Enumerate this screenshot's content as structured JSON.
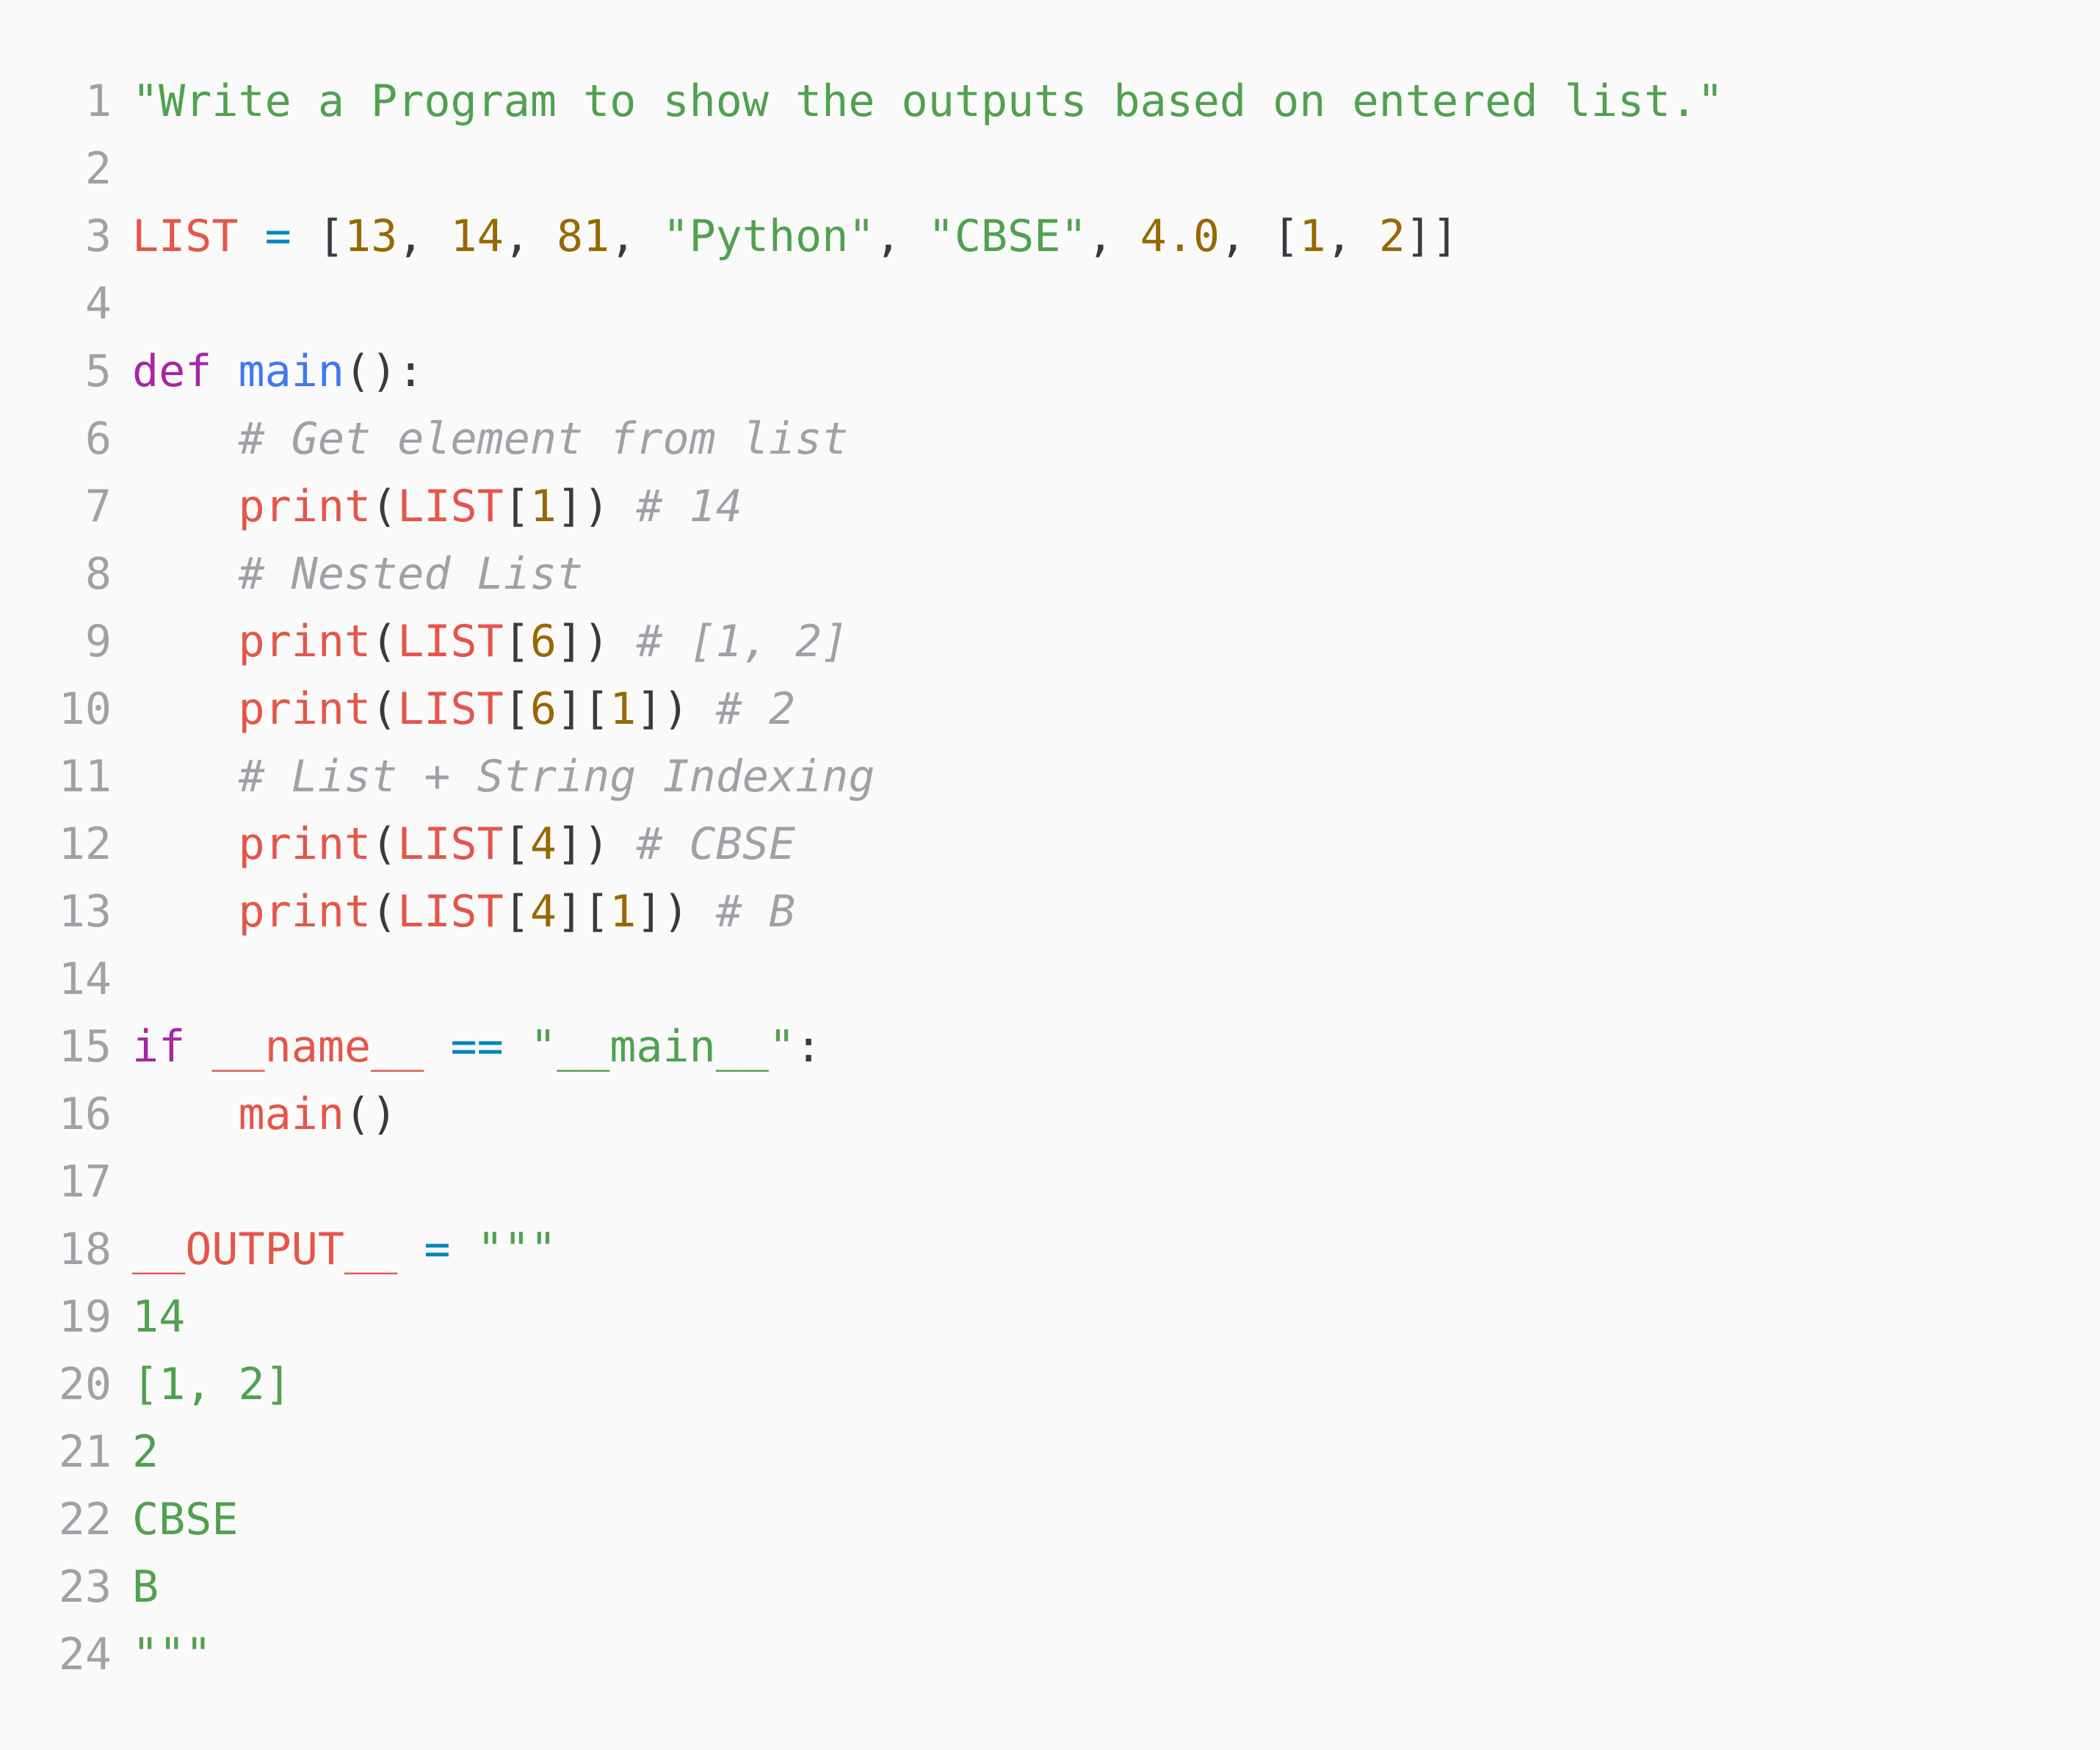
{
  "colors": {
    "background": "#fafafa",
    "line_number": "#a0a1a7",
    "string": "#50a14f",
    "number": "#986801",
    "variable": "#e45649",
    "keyword": "#a626a4",
    "function": "#4078f2",
    "operator": "#0184bc",
    "punctuation": "#383a42",
    "comment": "#a0a1a7"
  },
  "lines": [
    {
      "n": "1",
      "tokens": [
        {
          "t": "string",
          "v": "\"Write a Program to show the outputs based on entered list.\""
        }
      ]
    },
    {
      "n": "2",
      "tokens": []
    },
    {
      "n": "3",
      "tokens": [
        {
          "t": "var",
          "v": "LIST"
        },
        {
          "t": "plain",
          "v": " "
        },
        {
          "t": "op",
          "v": "="
        },
        {
          "t": "plain",
          "v": " "
        },
        {
          "t": "punct",
          "v": "["
        },
        {
          "t": "number",
          "v": "13"
        },
        {
          "t": "punct",
          "v": ", "
        },
        {
          "t": "number",
          "v": "14"
        },
        {
          "t": "punct",
          "v": ", "
        },
        {
          "t": "number",
          "v": "81"
        },
        {
          "t": "punct",
          "v": ", "
        },
        {
          "t": "string",
          "v": "\"Python\""
        },
        {
          "t": "punct",
          "v": ", "
        },
        {
          "t": "string",
          "v": "\"CBSE\""
        },
        {
          "t": "punct",
          "v": ", "
        },
        {
          "t": "number",
          "v": "4.0"
        },
        {
          "t": "punct",
          "v": ", "
        },
        {
          "t": "punct",
          "v": "["
        },
        {
          "t": "number",
          "v": "1"
        },
        {
          "t": "punct",
          "v": ", "
        },
        {
          "t": "number",
          "v": "2"
        },
        {
          "t": "punct",
          "v": "]]"
        }
      ]
    },
    {
      "n": "4",
      "tokens": []
    },
    {
      "n": "5",
      "tokens": [
        {
          "t": "keyword",
          "v": "def"
        },
        {
          "t": "plain",
          "v": " "
        },
        {
          "t": "func",
          "v": "main"
        },
        {
          "t": "punct",
          "v": "():"
        }
      ]
    },
    {
      "n": "6",
      "tokens": [
        {
          "t": "plain",
          "v": "    "
        },
        {
          "t": "comment",
          "v": "# Get element from list"
        }
      ]
    },
    {
      "n": "7",
      "tokens": [
        {
          "t": "plain",
          "v": "    "
        },
        {
          "t": "var",
          "v": "print"
        },
        {
          "t": "punct",
          "v": "("
        },
        {
          "t": "var",
          "v": "LIST"
        },
        {
          "t": "punct",
          "v": "["
        },
        {
          "t": "number",
          "v": "1"
        },
        {
          "t": "punct",
          "v": "])"
        },
        {
          "t": "plain",
          "v": " "
        },
        {
          "t": "comment",
          "v": "# 14"
        }
      ]
    },
    {
      "n": "8",
      "tokens": [
        {
          "t": "plain",
          "v": "    "
        },
        {
          "t": "comment",
          "v": "# Nested List"
        }
      ]
    },
    {
      "n": "9",
      "tokens": [
        {
          "t": "plain",
          "v": "    "
        },
        {
          "t": "var",
          "v": "print"
        },
        {
          "t": "punct",
          "v": "("
        },
        {
          "t": "var",
          "v": "LIST"
        },
        {
          "t": "punct",
          "v": "["
        },
        {
          "t": "number",
          "v": "6"
        },
        {
          "t": "punct",
          "v": "])"
        },
        {
          "t": "plain",
          "v": " "
        },
        {
          "t": "comment",
          "v": "# [1, 2]"
        }
      ]
    },
    {
      "n": "10",
      "tokens": [
        {
          "t": "plain",
          "v": "    "
        },
        {
          "t": "var",
          "v": "print"
        },
        {
          "t": "punct",
          "v": "("
        },
        {
          "t": "var",
          "v": "LIST"
        },
        {
          "t": "punct",
          "v": "["
        },
        {
          "t": "number",
          "v": "6"
        },
        {
          "t": "punct",
          "v": "]["
        },
        {
          "t": "number",
          "v": "1"
        },
        {
          "t": "punct",
          "v": "])"
        },
        {
          "t": "plain",
          "v": " "
        },
        {
          "t": "comment",
          "v": "# 2"
        }
      ]
    },
    {
      "n": "11",
      "tokens": [
        {
          "t": "plain",
          "v": "    "
        },
        {
          "t": "comment",
          "v": "# List + String Indexing"
        }
      ]
    },
    {
      "n": "12",
      "tokens": [
        {
          "t": "plain",
          "v": "    "
        },
        {
          "t": "var",
          "v": "print"
        },
        {
          "t": "punct",
          "v": "("
        },
        {
          "t": "var",
          "v": "LIST"
        },
        {
          "t": "punct",
          "v": "["
        },
        {
          "t": "number",
          "v": "4"
        },
        {
          "t": "punct",
          "v": "])"
        },
        {
          "t": "plain",
          "v": " "
        },
        {
          "t": "comment",
          "v": "# CBSE"
        }
      ]
    },
    {
      "n": "13",
      "tokens": [
        {
          "t": "plain",
          "v": "    "
        },
        {
          "t": "var",
          "v": "print"
        },
        {
          "t": "punct",
          "v": "("
        },
        {
          "t": "var",
          "v": "LIST"
        },
        {
          "t": "punct",
          "v": "["
        },
        {
          "t": "number",
          "v": "4"
        },
        {
          "t": "punct",
          "v": "]["
        },
        {
          "t": "number",
          "v": "1"
        },
        {
          "t": "punct",
          "v": "])"
        },
        {
          "t": "plain",
          "v": " "
        },
        {
          "t": "comment",
          "v": "# B"
        }
      ]
    },
    {
      "n": "14",
      "tokens": []
    },
    {
      "n": "15",
      "tokens": [
        {
          "t": "keyword",
          "v": "if"
        },
        {
          "t": "plain",
          "v": " "
        },
        {
          "t": "var",
          "v": "__name__"
        },
        {
          "t": "plain",
          "v": " "
        },
        {
          "t": "op",
          "v": "=="
        },
        {
          "t": "plain",
          "v": " "
        },
        {
          "t": "string",
          "v": "\"__main__\""
        },
        {
          "t": "punct",
          "v": ":"
        }
      ]
    },
    {
      "n": "16",
      "tokens": [
        {
          "t": "plain",
          "v": "    "
        },
        {
          "t": "var",
          "v": "main"
        },
        {
          "t": "punct",
          "v": "()"
        }
      ]
    },
    {
      "n": "17",
      "tokens": []
    },
    {
      "n": "18",
      "tokens": [
        {
          "t": "var",
          "v": "__OUTPUT__"
        },
        {
          "t": "plain",
          "v": " "
        },
        {
          "t": "op",
          "v": "="
        },
        {
          "t": "plain",
          "v": " "
        },
        {
          "t": "string",
          "v": "\"\"\""
        }
      ]
    },
    {
      "n": "19",
      "tokens": [
        {
          "t": "string",
          "v": "14"
        }
      ]
    },
    {
      "n": "20",
      "tokens": [
        {
          "t": "string",
          "v": "[1, 2]"
        }
      ]
    },
    {
      "n": "21",
      "tokens": [
        {
          "t": "string",
          "v": "2"
        }
      ]
    },
    {
      "n": "22",
      "tokens": [
        {
          "t": "string",
          "v": "CBSE"
        }
      ]
    },
    {
      "n": "23",
      "tokens": [
        {
          "t": "string",
          "v": "B"
        }
      ]
    },
    {
      "n": "24",
      "tokens": [
        {
          "t": "string",
          "v": "\"\"\""
        }
      ]
    }
  ]
}
